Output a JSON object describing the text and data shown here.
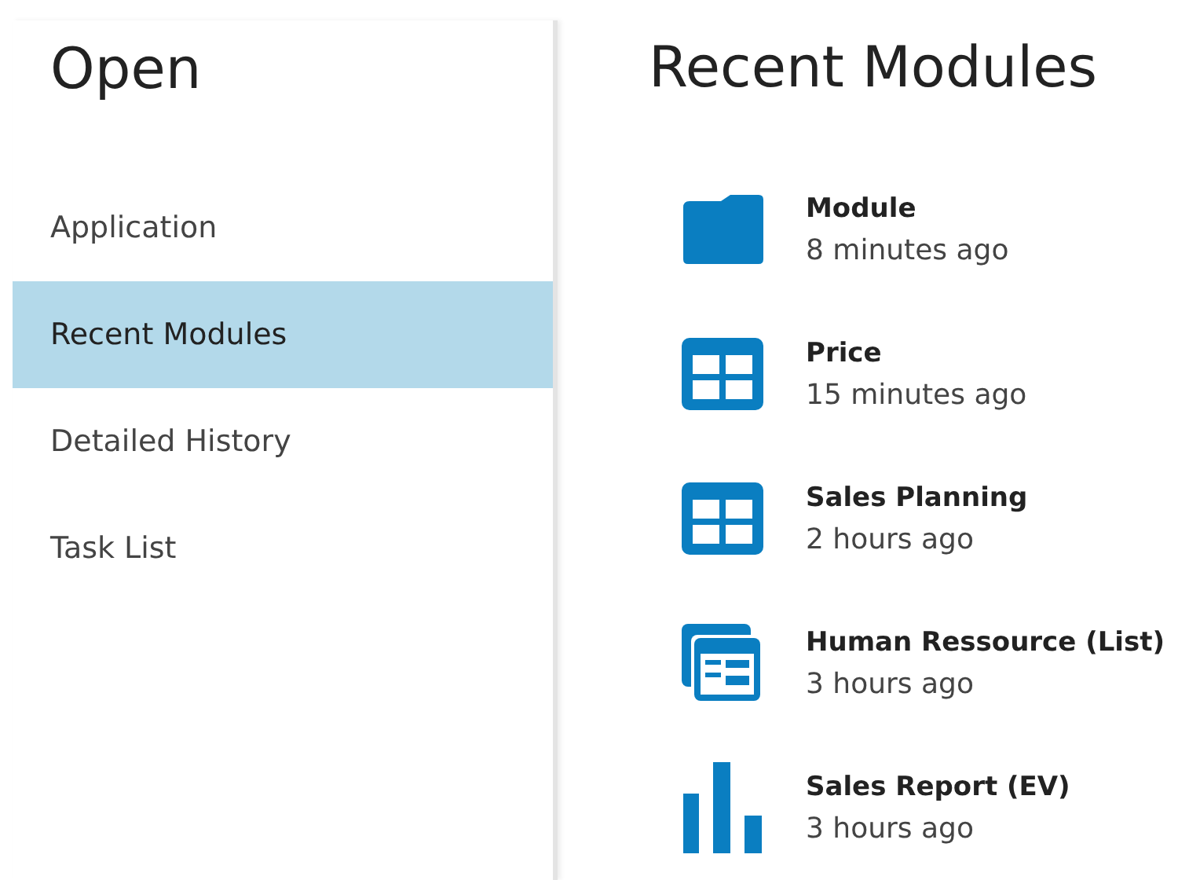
{
  "sidebar": {
    "title": "Open",
    "items": [
      {
        "label": "Application",
        "selected": false
      },
      {
        "label": "Recent Modules",
        "selected": true
      },
      {
        "label": "Detailed History",
        "selected": false
      },
      {
        "label": "Task List",
        "selected": false
      }
    ]
  },
  "main": {
    "title": "Recent Modules",
    "modules": [
      {
        "kind": "folder",
        "name": "Module",
        "time": "8 minutes ago"
      },
      {
        "kind": "grid",
        "name": "Price",
        "time": "15 minutes ago"
      },
      {
        "kind": "grid",
        "name": "Sales Planning",
        "time": "2 hours ago"
      },
      {
        "kind": "list",
        "name": "Human Ressource (List)",
        "time": "3 hours ago"
      },
      {
        "kind": "chart",
        "name": "Sales Report (EV)",
        "time": "3 hours ago"
      }
    ]
  }
}
